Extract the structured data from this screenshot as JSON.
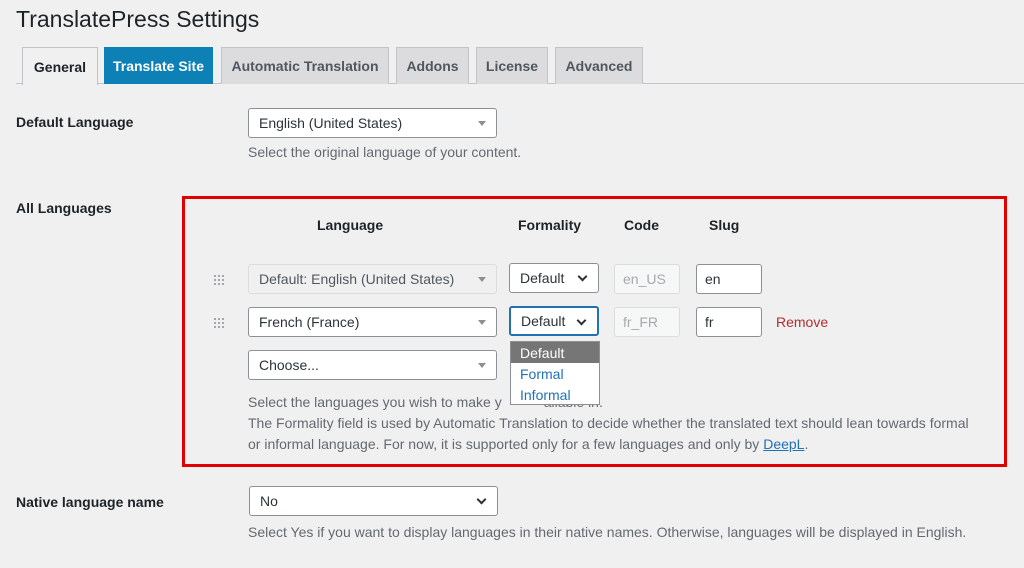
{
  "page_title": "TranslatePress Settings",
  "tabs": [
    {
      "label": "General"
    },
    {
      "label": "Translate Site"
    },
    {
      "label": "Automatic Translation"
    },
    {
      "label": "Addons"
    },
    {
      "label": "License"
    },
    {
      "label": "Advanced"
    }
  ],
  "default_language": {
    "label": "Default Language",
    "value": "English (United States)",
    "description": "Select the original language of your content."
  },
  "all_languages": {
    "label": "All Languages",
    "columns": {
      "language": "Language",
      "formality": "Formality",
      "code": "Code",
      "slug": "Slug"
    },
    "rows": [
      {
        "language": "Default: English (United States)",
        "formality": "Default",
        "code": "en_US",
        "slug": "en"
      },
      {
        "language": "French (France)",
        "formality": "Default",
        "code": "fr_FR",
        "slug": "fr",
        "remove": "Remove"
      }
    ],
    "choose_placeholder": "Choose...",
    "formality_options": [
      "Default",
      "Formal",
      "Informal"
    ],
    "description_1_left": "Select the languages you wish to make y",
    "description_1_right": "ailable in.",
    "description_2_line1": "The Formality field is used by Automatic Translation to decide whether the translated text should lean towards formal",
    "description_2_line2": "or informal language. For now, it is supported only for a few languages and only by ",
    "description_2_link": "DeepL",
    "description_2_end": "."
  },
  "native_language": {
    "label": "Native language name",
    "value": "No",
    "description": "Select Yes if you want to display languages in their native names. Otherwise, languages will be displayed in English."
  },
  "colors": {
    "accent": "#0d81b5",
    "highlight_border": "#e00000",
    "remove": "#b32d2e",
    "link": "#2271b1"
  }
}
